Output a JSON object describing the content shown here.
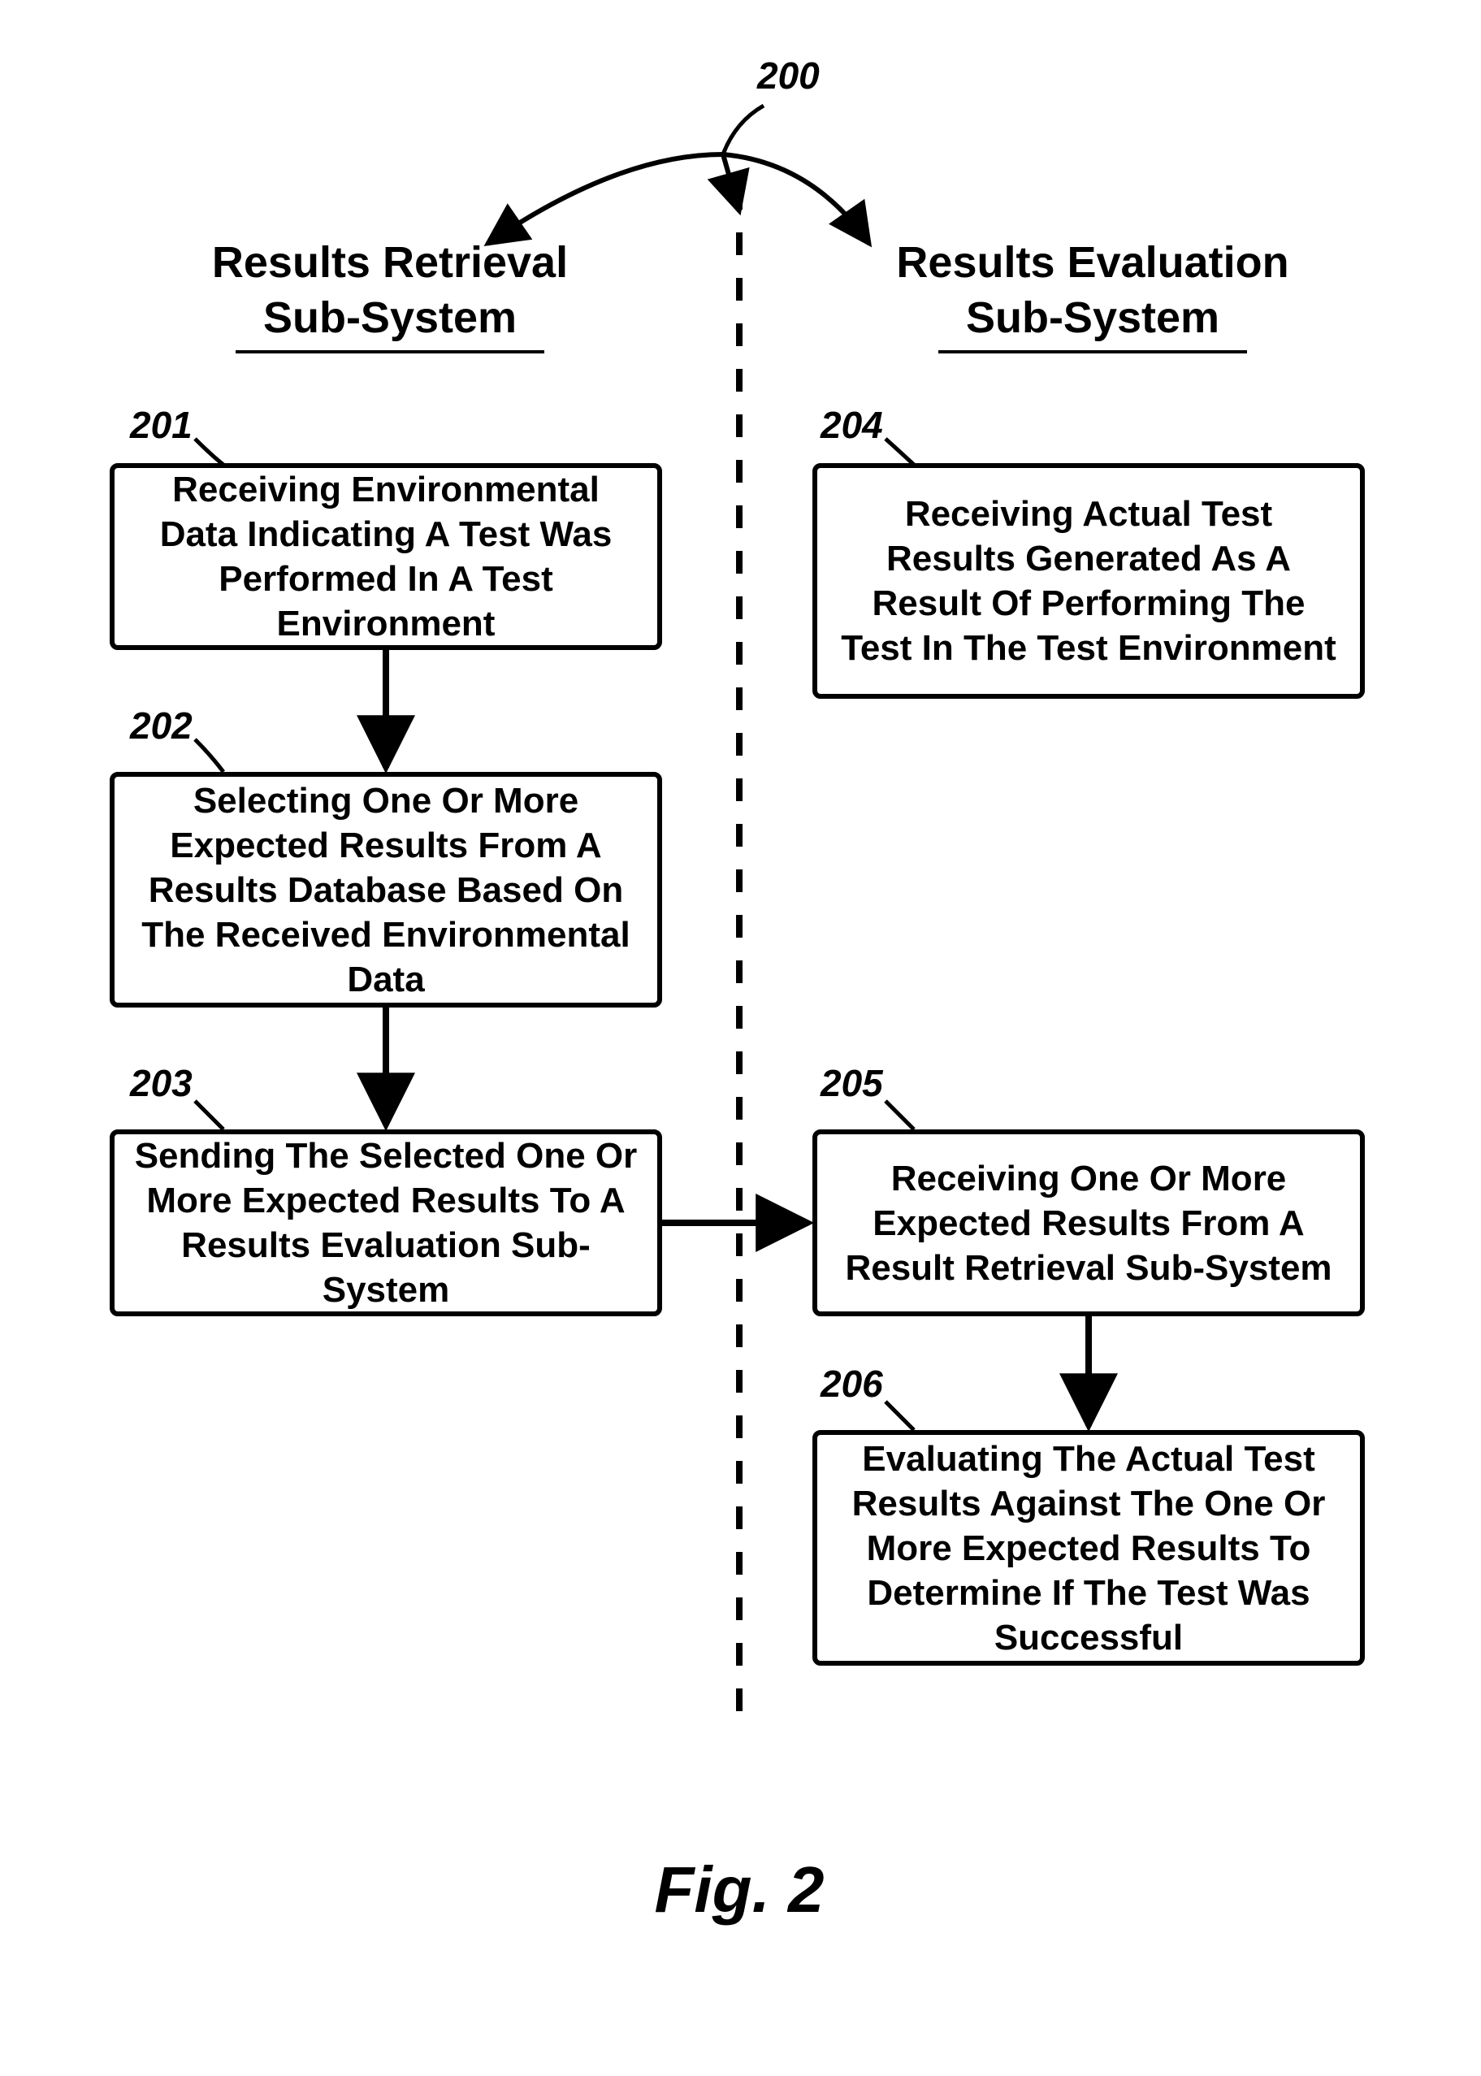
{
  "figure": {
    "ref_overall": "200",
    "left_heading": "Results Retrieval\nSub-System",
    "right_heading": "Results Evaluation\nSub-System",
    "caption": "Fig. 2"
  },
  "boxes": {
    "b201": {
      "ref": "201",
      "text": "Receiving Environmental Data Indicating A Test Was Performed In A Test Environment"
    },
    "b202": {
      "ref": "202",
      "text": "Selecting One Or More Expected Results From A Results Database Based On The Received Environmental Data"
    },
    "b203": {
      "ref": "203",
      "text": "Sending The Selected One Or More Expected Results To A Results Evaluation Sub-System"
    },
    "b204": {
      "ref": "204",
      "text": "Receiving Actual Test Results Generated As A Result Of Performing The Test In The Test Environment"
    },
    "b205": {
      "ref": "205",
      "text": "Receiving One Or More Expected Results From A Result Retrieval Sub-System"
    },
    "b206": {
      "ref": "206",
      "text": "Evaluating The Actual Test Results Against The One Or More Expected Results To Determine If The Test Was Successful"
    }
  }
}
